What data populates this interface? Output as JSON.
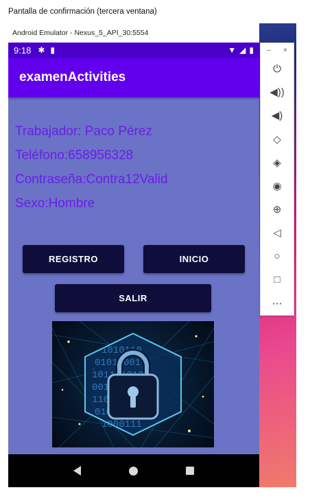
{
  "caption": "Pantalla de confirmación (tercera ventana)",
  "emulator": {
    "title": "Android Emulator - Nexus_5_API_30:5554",
    "toolbar": {
      "minimize": "–",
      "close": "×",
      "items": [
        {
          "icon": "power-icon",
          "glyph": "⏻"
        },
        {
          "icon": "volume-up-icon",
          "glyph": "🔊"
        },
        {
          "icon": "volume-down-icon",
          "glyph": "🔉"
        },
        {
          "icon": "rotate-left-icon",
          "glyph": "⟲"
        },
        {
          "icon": "rotate-right-icon",
          "glyph": "⟳"
        },
        {
          "icon": "camera-icon",
          "glyph": "📷"
        },
        {
          "icon": "zoom-icon",
          "glyph": "🔍"
        },
        {
          "icon": "back-icon",
          "glyph": "◁"
        },
        {
          "icon": "home-icon",
          "glyph": "○"
        },
        {
          "icon": "overview-icon",
          "glyph": "□"
        },
        {
          "icon": "more-icon",
          "glyph": "⋯"
        }
      ]
    }
  },
  "status_bar": {
    "time": "9:18",
    "left_icons": [
      "settings-icon",
      "sd-card-icon"
    ],
    "right_icons": [
      "wifi-icon",
      "signal-icon",
      "battery-icon"
    ]
  },
  "app": {
    "title": "examenActivities",
    "fields": {
      "worker": "Trabajador: Paco Pérez",
      "phone": "Teléfono:658956328",
      "password": "Contraseña:Contra12Valid",
      "sex": "Sexo:Hombre"
    },
    "buttons": {
      "registro": "REGISTRO",
      "inicio": "INICIO",
      "salir": "SALIR"
    },
    "image": {
      "icon": "padlock-icon"
    }
  },
  "colors": {
    "statusbar": "#4a00c9",
    "appbar": "#6200ee",
    "background": "#6b73c6",
    "text": "#6a1ee6",
    "button": "#0f0e3b"
  }
}
